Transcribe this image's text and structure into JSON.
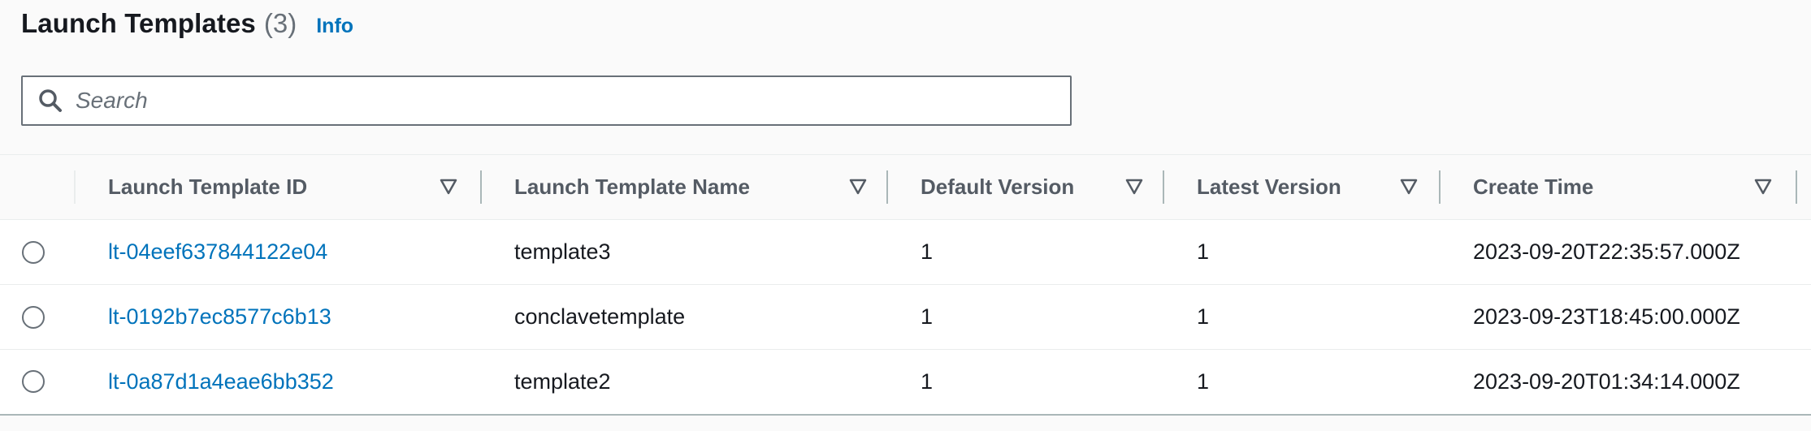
{
  "header": {
    "title": "Launch Templates",
    "count": "(3)",
    "info_label": "Info"
  },
  "search": {
    "placeholder": "Search",
    "value": ""
  },
  "icons": {
    "search": "search-icon",
    "sort": "sort-caret-down-icon",
    "radio": "radio-button-icon"
  },
  "colors": {
    "link": "#0073bb",
    "header_text": "#545b64",
    "background": "#fafafa"
  },
  "table": {
    "columns": [
      {
        "label": "Launch Template ID"
      },
      {
        "label": "Launch Template Name"
      },
      {
        "label": "Default Version"
      },
      {
        "label": "Latest Version"
      },
      {
        "label": "Create Time"
      }
    ],
    "rows": [
      {
        "id": "lt-04eef637844122e04",
        "name": "template3",
        "default_version": "1",
        "latest_version": "1",
        "create_time": "2023-09-20T22:35:57.000Z",
        "selected": false
      },
      {
        "id": "lt-0192b7ec8577c6b13",
        "name": "conclavetemplate",
        "default_version": "1",
        "latest_version": "1",
        "create_time": "2023-09-23T18:45:00.000Z",
        "selected": false
      },
      {
        "id": "lt-0a87d1a4eae6bb352",
        "name": "template2",
        "default_version": "1",
        "latest_version": "1",
        "create_time": "2023-09-20T01:34:14.000Z",
        "selected": false
      }
    ]
  }
}
